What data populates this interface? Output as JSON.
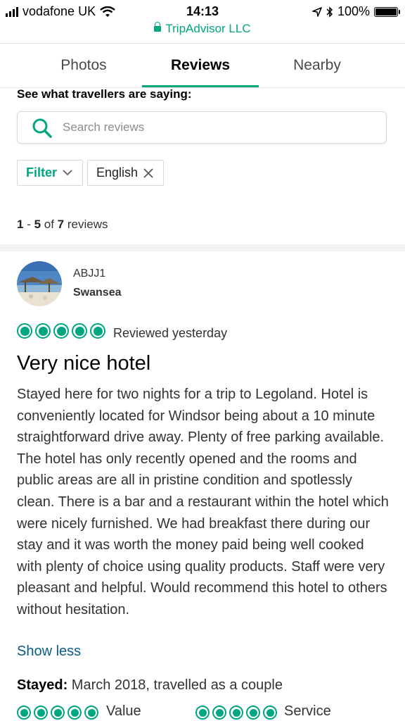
{
  "status_bar": {
    "carrier": "vodafone UK",
    "time": "14:13",
    "battery": "100%",
    "battery_level": 1.0,
    "icons": [
      "signal-icon",
      "wifi-icon",
      "location-arrow-icon",
      "bluetooth-icon",
      "battery-icon"
    ]
  },
  "browser": {
    "url_label": "TripAdvisor LLC"
  },
  "tabs": [
    {
      "label": "Photos",
      "active": false
    },
    {
      "label": "Reviews",
      "active": true
    },
    {
      "label": "Nearby",
      "active": false
    }
  ],
  "section": {
    "heading": "See what travellers are saying:"
  },
  "search": {
    "placeholder": "Search reviews",
    "value": ""
  },
  "filters": {
    "filter_label": "Filter",
    "language_label": "English"
  },
  "results": {
    "range_start": "1",
    "range_sep": " - ",
    "range_end": "5",
    "of_text": " of ",
    "total": "7",
    "suffix": " reviews"
  },
  "review": {
    "username": "ABJJ1",
    "location": "Swansea",
    "rating": 5,
    "reviewed_text": "Reviewed yesterday",
    "title": "Very nice hotel",
    "body": "Stayed here for two nights for a trip to Legoland. Hotel is conveniently located for Windsor being about a 10 minute straightforward drive away. Plenty of free parking available. The hotel has only recently opened and the rooms and public areas are all in pristine condition and spotlessly clean. There is a bar and a restaurant within the hotel which were nicely furnished. We had breakfast there during our stay and it was worth the money paid being well cooked with plenty of choice using quality products. Staff were very pleasant and helpful. Would recommend this hotel to others without hesitation.",
    "show_less": "Show less",
    "stayed_label": "Stayed:",
    "stayed_value": " March 2018, travelled as a couple",
    "subratings": [
      {
        "label": "Value",
        "rating": 5
      },
      {
        "label": "Service",
        "rating": 5
      }
    ]
  },
  "colors": {
    "accent": "#00a680",
    "link": "#0a5b87"
  }
}
